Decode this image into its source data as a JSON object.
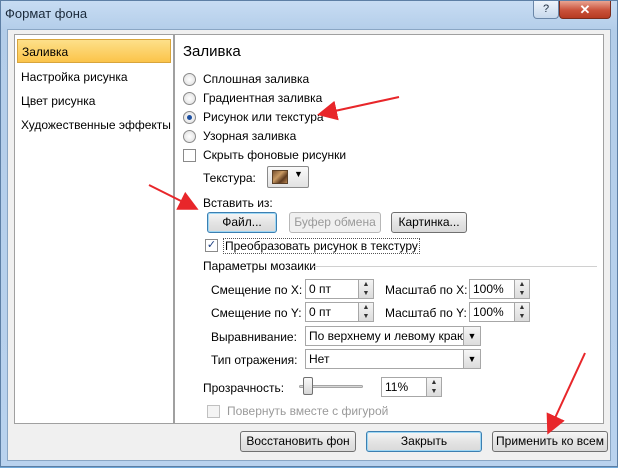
{
  "window": {
    "title": "Формат фона",
    "help_label": "?",
    "close_label": "✕"
  },
  "sidebar": {
    "items": [
      {
        "label": "Заливка",
        "selected": true
      },
      {
        "label": "Настройка рисунка",
        "selected": false
      },
      {
        "label": "Цвет рисунка",
        "selected": false
      },
      {
        "label": "Художественные эффекты",
        "selected": false
      }
    ]
  },
  "fill": {
    "heading": "Заливка",
    "options": [
      {
        "label": "Сплошная заливка",
        "selected": false
      },
      {
        "label": "Градиентная заливка",
        "selected": false
      },
      {
        "label": "Рисунок или текстура",
        "selected": true
      },
      {
        "label": "Узорная заливка",
        "selected": false
      }
    ],
    "hide_background": {
      "label": "Скрыть фоновые рисунки",
      "checked": false
    },
    "texture_label": "Текстура:",
    "texture_icon": "wood-texture-swatch",
    "insert_from_label": "Вставить из:",
    "file_button": "Файл...",
    "clipboard_button": "Буфер обмена",
    "clipart_button": "Картинка...",
    "tile_checkbox": {
      "label": "Преобразовать рисунок в текстуру",
      "checked": true
    },
    "tiling_group": "Параметры мозаики",
    "offset_x_label": "Смещение по X:",
    "offset_x_value": "0 пт",
    "scale_x_label": "Масштаб по X:",
    "scale_x_value": "100%",
    "offset_y_label": "Смещение по Y:",
    "offset_y_value": "0 пт",
    "scale_y_label": "Масштаб по Y:",
    "scale_y_value": "100%",
    "alignment_label": "Выравнивание:",
    "alignment_value": "По верхнему и левому краю",
    "mirror_label": "Тип отражения:",
    "mirror_value": "Нет",
    "transparency_label": "Прозрачность:",
    "transparency_value": "11%",
    "transparency_fraction": 0.11,
    "rotate_with_shape": {
      "label": "Повернуть вместе с фигурой",
      "checked": false,
      "disabled": true
    }
  },
  "footer": {
    "reset_button": "Восстановить фон",
    "close_button": "Закрыть",
    "apply_all_button": "Применить ко всем"
  },
  "colors": {
    "selected_item": "#fbc44a",
    "annotation_arrow": "#e8262a"
  }
}
